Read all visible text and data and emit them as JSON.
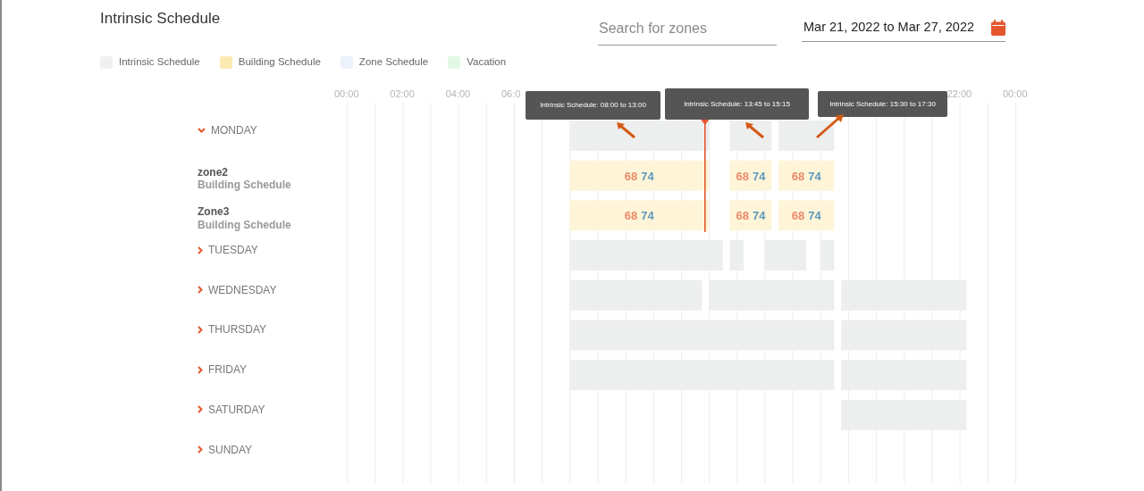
{
  "title": "Intrinsic Schedule",
  "search": {
    "placeholder": "Search for zones"
  },
  "date_range": {
    "value": "Mar 21, 2022 to Mar 27, 2022"
  },
  "legend": [
    {
      "label": "Intrinsic Schedule",
      "color": "#f0f0f0"
    },
    {
      "label": "Building Schedule",
      "color": "#fde9b3"
    },
    {
      "label": "Zone Schedule",
      "color": "#edf1fc"
    },
    {
      "label": "Vacation",
      "color": "#e2f9e5"
    }
  ],
  "tooltips": [
    {
      "text": "Intrinsic Schedule: 08:00 to 13:00"
    },
    {
      "text": "Intrinsic Schedule: 13:45 to 15:15"
    },
    {
      "text": "Intrinsic Schedule: 15:30 to 17:30"
    }
  ],
  "days": [
    {
      "label": "MONDAY",
      "expanded": true,
      "zones": [
        {
          "name": "zone2",
          "schedule": "Building Schedule",
          "setpoints": [
            {
              "low": "68",
              "high": "74"
            },
            {
              "low": "68",
              "high": "74"
            },
            {
              "low": "68",
              "high": "74"
            }
          ]
        },
        {
          "name": "Zone3",
          "schedule": "Building Schedule",
          "setpoints": [
            {
              "low": "68",
              "high": "74"
            },
            {
              "low": "68",
              "high": "74"
            },
            {
              "low": "68",
              "high": "74"
            }
          ]
        }
      ]
    },
    {
      "label": "TUESDAY",
      "expanded": false
    },
    {
      "label": "WEDNESDAY",
      "expanded": false
    },
    {
      "label": "THURSDAY",
      "expanded": false
    },
    {
      "label": "FRIDAY",
      "expanded": false
    },
    {
      "label": "SATURDAY",
      "expanded": false
    },
    {
      "label": "SUNDAY",
      "expanded": false
    }
  ],
  "time_axis": [
    "00:00",
    "02:00",
    "04:00",
    "06:0",
    "22:00",
    "00:00"
  ]
}
